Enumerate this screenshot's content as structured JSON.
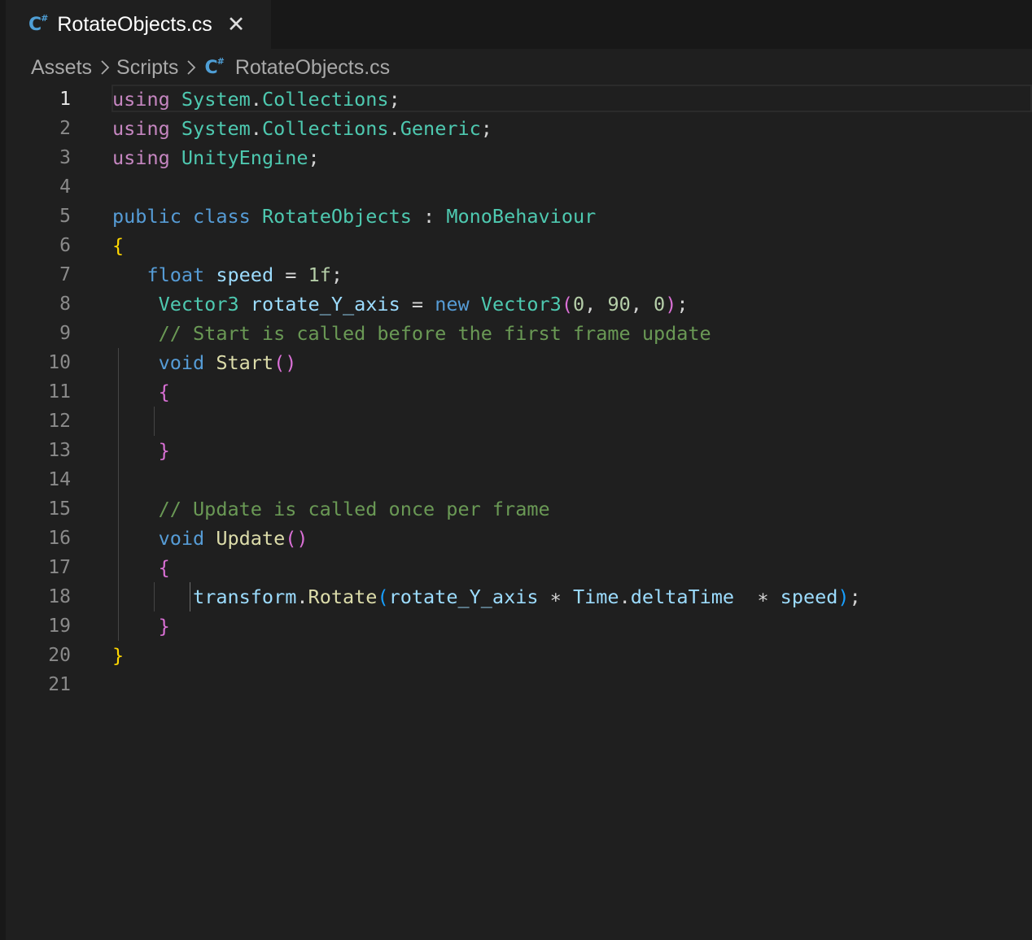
{
  "tab": {
    "title": "RotateObjects.cs",
    "icon": "csharp-file-icon",
    "close_glyph": "✕"
  },
  "breadcrumb": {
    "items": [
      "Assets",
      "Scripts",
      "RotateObjects.cs"
    ]
  },
  "editor": {
    "active_line": 1,
    "line_numbers": [
      "1",
      "2",
      "3",
      "4",
      "5",
      "6",
      "7",
      "8",
      "9",
      "10",
      "11",
      "12",
      "13",
      "14",
      "15",
      "16",
      "17",
      "18",
      "19",
      "20",
      "21"
    ],
    "lines": [
      {
        "indent": "",
        "tokens": [
          [
            "kw-ctrl",
            "using"
          ],
          [
            "",
            "",
            " "
          ],
          [
            "type",
            "System"
          ],
          [
            "punc",
            "."
          ],
          [
            "type",
            "Collections"
          ],
          [
            "punc",
            ";"
          ]
        ]
      },
      {
        "indent": "",
        "tokens": [
          [
            "kw-ctrl",
            "using"
          ],
          [
            "punc",
            " "
          ],
          [
            "type",
            "System"
          ],
          [
            "punc",
            "."
          ],
          [
            "type",
            "Collections"
          ],
          [
            "punc",
            "."
          ],
          [
            "type",
            "Generic"
          ],
          [
            "punc",
            ";"
          ]
        ]
      },
      {
        "indent": "",
        "tokens": [
          [
            "kw-ctrl",
            "using"
          ],
          [
            "punc",
            " "
          ],
          [
            "type",
            "UnityEngine"
          ],
          [
            "punc",
            ";"
          ]
        ]
      },
      {
        "indent": "",
        "tokens": []
      },
      {
        "indent": "",
        "tokens": [
          [
            "kw",
            "public"
          ],
          [
            "punc",
            " "
          ],
          [
            "kw",
            "class"
          ],
          [
            "punc",
            " "
          ],
          [
            "type",
            "RotateObjects"
          ],
          [
            "punc",
            " : "
          ],
          [
            "type",
            "MonoBehaviour"
          ]
        ]
      },
      {
        "indent": "",
        "tokens": [
          [
            "b1",
            "{"
          ]
        ]
      },
      {
        "indent": "   ",
        "tokens": [
          [
            "kw",
            "float"
          ],
          [
            "punc",
            " "
          ],
          [
            "var",
            "speed"
          ],
          [
            "punc",
            " = "
          ],
          [
            "num",
            "1f"
          ],
          [
            "punc",
            ";"
          ]
        ]
      },
      {
        "indent": "    ",
        "tokens": [
          [
            "type",
            "Vector3"
          ],
          [
            "punc",
            " "
          ],
          [
            "var",
            "rotate_Y_axis"
          ],
          [
            "punc",
            " = "
          ],
          [
            "kw",
            "new"
          ],
          [
            "punc",
            " "
          ],
          [
            "type",
            "Vector3"
          ],
          [
            "b2",
            "("
          ],
          [
            "num",
            "0"
          ],
          [
            "punc",
            ", "
          ],
          [
            "num",
            "90"
          ],
          [
            "punc",
            ", "
          ],
          [
            "num",
            "0"
          ],
          [
            "b2",
            ")"
          ],
          [
            "punc",
            ";"
          ]
        ]
      },
      {
        "indent": "    ",
        "tokens": [
          [
            "cmt",
            "// Start is called before the first frame update"
          ]
        ]
      },
      {
        "indent": "    ",
        "tokens": [
          [
            "kw",
            "void"
          ],
          [
            "punc",
            " "
          ],
          [
            "fn",
            "Start"
          ],
          [
            "b2",
            "()"
          ]
        ]
      },
      {
        "indent": "    ",
        "tokens": [
          [
            "b2",
            "{"
          ]
        ]
      },
      {
        "indent": "",
        "tokens": []
      },
      {
        "indent": "    ",
        "tokens": [
          [
            "b2",
            "}"
          ]
        ]
      },
      {
        "indent": "",
        "tokens": []
      },
      {
        "indent": "    ",
        "tokens": [
          [
            "cmt",
            "// Update is called once per frame"
          ]
        ]
      },
      {
        "indent": "    ",
        "tokens": [
          [
            "kw",
            "void"
          ],
          [
            "punc",
            " "
          ],
          [
            "fn",
            "Update"
          ],
          [
            "b2",
            "()"
          ]
        ]
      },
      {
        "indent": "    ",
        "tokens": [
          [
            "b2",
            "{"
          ]
        ]
      },
      {
        "indent": "       ",
        "tokens": [
          [
            "var",
            "transform"
          ],
          [
            "punc",
            "."
          ],
          [
            "fn",
            "Rotate"
          ],
          [
            "b3",
            "("
          ],
          [
            "var",
            "rotate_Y_axis"
          ],
          [
            "punc",
            " ∗ "
          ],
          [
            "var",
            "Time"
          ],
          [
            "punc",
            "."
          ],
          [
            "var",
            "deltaTime"
          ],
          [
            "punc",
            "  ∗ "
          ],
          [
            "var",
            "speed"
          ],
          [
            "b3",
            ")"
          ],
          [
            "punc",
            ";"
          ]
        ]
      },
      {
        "indent": "    ",
        "tokens": [
          [
            "b2",
            "}"
          ]
        ]
      },
      {
        "indent": "",
        "tokens": [
          [
            "b1",
            "}"
          ]
        ]
      },
      {
        "indent": "",
        "tokens": []
      }
    ]
  },
  "colors": {
    "background": "#1f1f1f",
    "tabbar": "#181818",
    "keyword_control": "#c586c0",
    "keyword": "#569cd6",
    "type": "#4ec9b0",
    "variable": "#9cdcfe",
    "function": "#dcdcaa",
    "number": "#b5cea8",
    "comment": "#6a9955",
    "bracket_level1": "#ffd700",
    "bracket_level2": "#da70d6",
    "bracket_level3": "#179fff"
  }
}
